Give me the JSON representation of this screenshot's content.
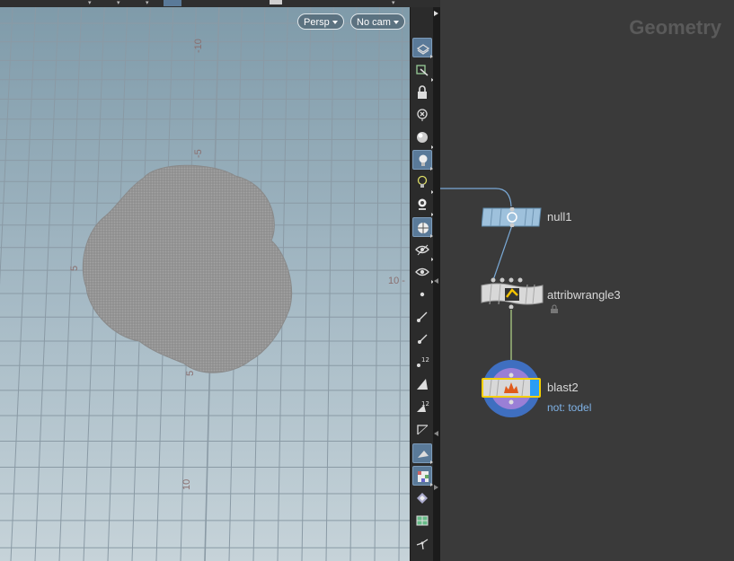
{
  "viewport": {
    "camera_mode": "Persp",
    "camera_select": "No cam",
    "grid_labels": [
      "-10",
      "-5",
      "5",
      "10",
      "5",
      "10"
    ],
    "grid_label_edge": "10 -"
  },
  "toolbar": {
    "icons": [
      "display-options-icon",
      "ghost-objects-icon",
      "lock-camera-icon",
      "snapshot-icon",
      "shading-icon",
      "light-icon",
      "headlight-icon",
      "display-lights-icon",
      "wireframe-shaded-icon",
      "visibility-icon",
      "eye-options-icon",
      "point-display-icon",
      "point-normal-icon",
      "primitive-normal-icon",
      "point-numbers-icon",
      "vertex-icon",
      "vertex-numbers-icon",
      "profile-icon",
      "backface-icon",
      "texture-icon",
      "uv-icon",
      "mesh-icon",
      "origin-icon"
    ]
  },
  "network": {
    "context_title": "Geometry",
    "nodes": [
      {
        "name": "null1",
        "comment": ""
      },
      {
        "name": "attribwrangle3",
        "comment": ""
      },
      {
        "name": "blast2",
        "comment": "not: todel"
      }
    ]
  },
  "colors": {
    "node_blue": "#9ec1dc",
    "node_white": "#d8d8d8",
    "wire_blue": "#7aa9d6",
    "wire_green": "#b7d98b",
    "display_ring": "#3f6fc0",
    "render_ring": "#9a7fd6",
    "selected_outline": "#f5d000",
    "comment_text": "#7fb2e6"
  }
}
